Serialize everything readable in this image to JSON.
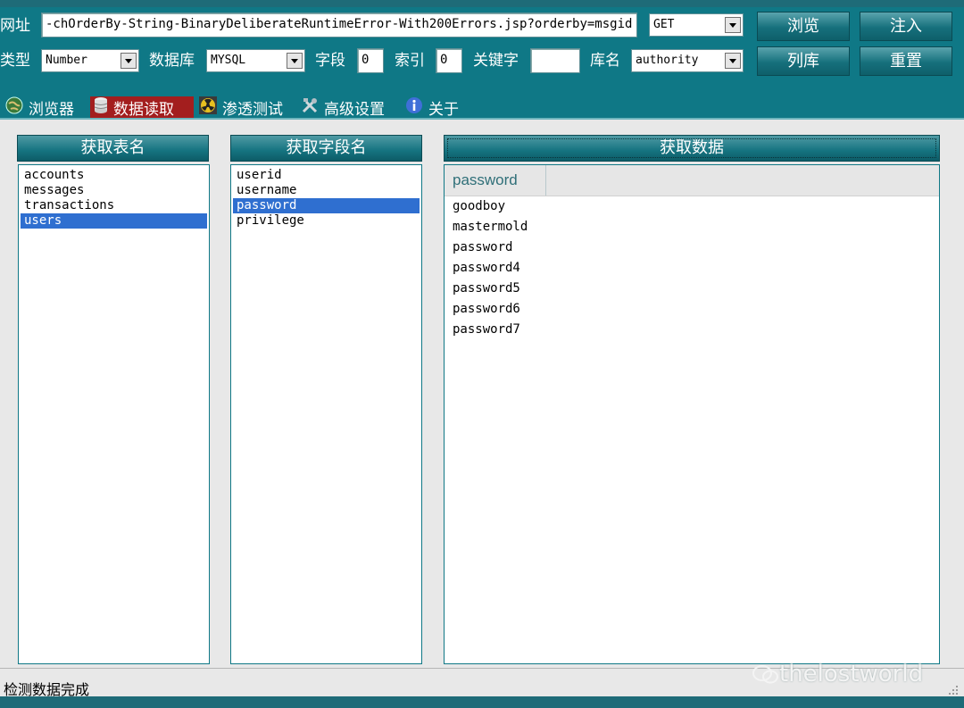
{
  "form": {
    "url_label": "网址",
    "url_value": "-chOrderBy-String-BinaryDeliberateRuntimeError-With200Errors.jsp?orderby=msgid",
    "method_value": "GET",
    "type_label": "类型",
    "type_value": "Number",
    "db_label": "数据库",
    "db_value": "MYSQL",
    "field_label": "字段",
    "field_value": "0",
    "index_label": "索引",
    "index_value": "0",
    "keyword_label": "关键字",
    "keyword_value": "",
    "libname_label": "库名",
    "libname_value": "authority"
  },
  "buttons": {
    "browse": "浏览",
    "inject": "注入",
    "list_db": "列库",
    "reset": "重置"
  },
  "tabs": [
    {
      "label": "浏览器",
      "icon": "globe-icon"
    },
    {
      "label": "数据读取",
      "icon": "database-icon"
    },
    {
      "label": "渗透测试",
      "icon": "radiation-icon"
    },
    {
      "label": "高级设置",
      "icon": "tools-icon"
    },
    {
      "label": "关于",
      "icon": "info-icon"
    }
  ],
  "panels": {
    "tables_header": "获取表名",
    "fields_header": "获取字段名",
    "data_header": "获取数据"
  },
  "tables": [
    "accounts",
    "messages",
    "transactions",
    "users"
  ],
  "fields": [
    "userid",
    "username",
    "password",
    "privilege"
  ],
  "data": {
    "column": "password",
    "rows": [
      "goodboy",
      "mastermold",
      "password",
      "password4",
      "password5",
      "password6",
      "password7"
    ]
  },
  "status": "检测数据完成",
  "watermark": "thelostworld",
  "colors": {
    "teal": "#0f7886",
    "active_tab": "#a31e1e",
    "selection": "#2f6fd0"
  }
}
